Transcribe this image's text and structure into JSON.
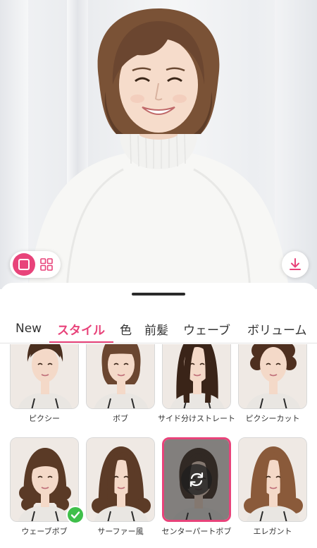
{
  "preview": {
    "image": "portrait-photo",
    "view_toggle": {
      "single_icon": "single-square-icon",
      "grid_icon": "grid-2x2-icon",
      "active": "single"
    },
    "download_icon": "download-icon"
  },
  "tabs": [
    {
      "label": "New"
    },
    {
      "label": "スタイル",
      "active": true
    },
    {
      "label": "色"
    },
    {
      "label": "前髪"
    },
    {
      "label": "ウェーブ"
    },
    {
      "label": "ボリューム"
    }
  ],
  "styles": [
    {
      "label": "ピクシー",
      "hair": "pixie",
      "hair_color": "#4a2f1f"
    },
    {
      "label": "ボブ",
      "hair": "bob",
      "hair_color": "#6b4630"
    },
    {
      "label": "サイド分けストレート",
      "hair": "long-straight",
      "hair_color": "#3a2418"
    },
    {
      "label": "ピクシーカット",
      "hair": "curly-short",
      "hair_color": "#4e2f1f"
    },
    {
      "label": "ウェーブボブ",
      "hair": "wavy",
      "hair_color": "#5a3a26",
      "applied": true
    },
    {
      "label": "サーファー風",
      "hair": "long-wavy",
      "hair_color": "#5c3b27"
    },
    {
      "label": "センターパートボブ",
      "hair": "center-bob",
      "hair_color": "#3c2a20",
      "selected": true
    },
    {
      "label": "エレガント",
      "hair": "long-wavy",
      "hair_color": "#8a5a3a"
    }
  ],
  "colors": {
    "accent": "#e8437a",
    "applied_badge": "#3fbf4a"
  }
}
